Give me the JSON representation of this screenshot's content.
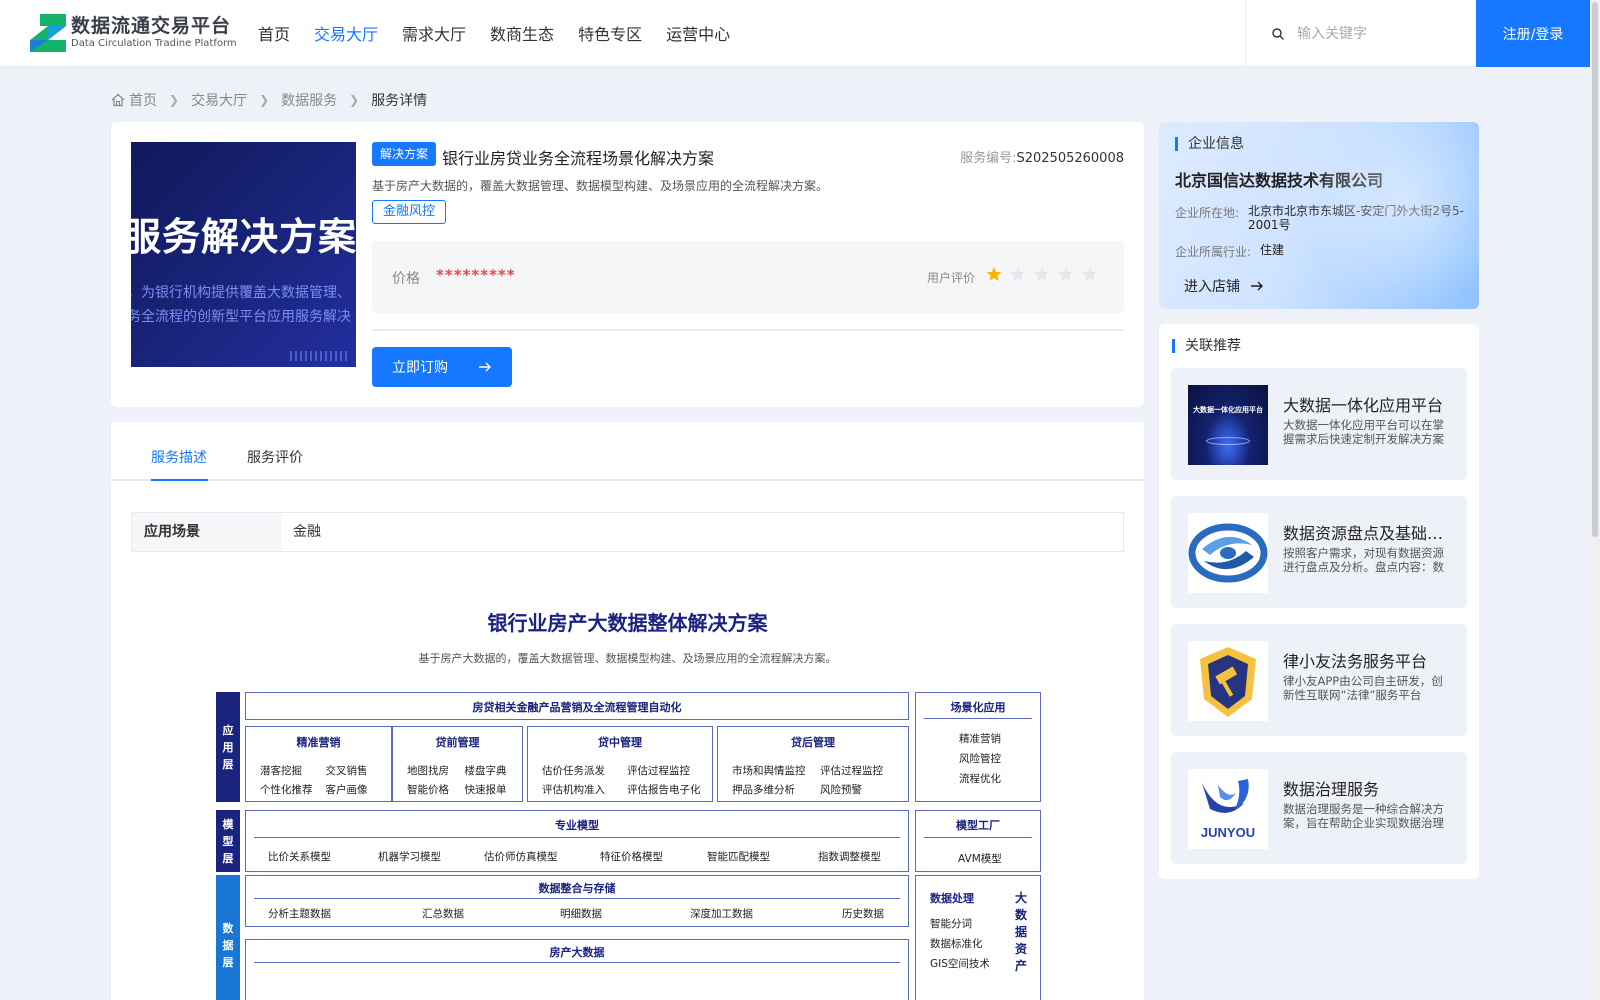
{
  "header": {
    "logo_cn": "数据流通交易平台",
    "logo_en": "Data Circulation Tradine Platform",
    "nav": [
      {
        "label": "首页",
        "active": false
      },
      {
        "label": "交易大厅",
        "active": true
      },
      {
        "label": "需求大厅",
        "active": false
      },
      {
        "label": "数商生态",
        "active": false
      },
      {
        "label": "特色专区",
        "active": false
      },
      {
        "label": "运营中心",
        "active": false
      }
    ],
    "search_placeholder": "输入关键字",
    "login_label": "注册/登录"
  },
  "breadcrumb": [
    "首页",
    "交易大厅",
    "数据服务",
    "服务详情"
  ],
  "product": {
    "cover_title": "服务解决方案",
    "cover_line1": "，为银行机构提供覆盖大数据管理、",
    "cover_line2": "务全流程的创新型平台应用服务解决",
    "type_tag": "解决方案",
    "title": "银行业房贷业务全流程场景化解决方案",
    "service_no_label": "服务编号:",
    "service_no": "S202505260008",
    "description": "基于房产大数据的，覆盖大数据管理、数据模型构建、及场景应用的全流程解决方案。",
    "category_tag": "金融风控",
    "price_label": "价格",
    "price_value": "*********",
    "rating_label": "用户评价",
    "rating": 1,
    "rating_max": 5,
    "buy_label": "立即订购"
  },
  "tabs": [
    {
      "label": "服务描述",
      "active": true
    },
    {
      "label": "服务评价",
      "active": false
    }
  ],
  "attributes": [
    {
      "key": "应用场景",
      "value": "金融"
    }
  ],
  "diagram": {
    "title": "银行业房产大数据整体解决方案",
    "subtitle": "基于房产大数据的，覆盖大数据管理、数据模型构建、及场景应用的全流程解决方案。",
    "layer_app": "应用层",
    "layer_model": "模型层",
    "layer_data": "数据层",
    "app_banner": "房贷相关金融产品营销及全流程管理自动化",
    "app_groups": [
      {
        "title": "精准营销",
        "items": [
          "潜客挖掘",
          "交叉销售",
          "个性化推荐",
          "客户画像"
        ]
      },
      {
        "title": "贷前管理",
        "items": [
          "地图找房",
          "楼盘字典",
          "智能价格",
          "快速报单"
        ]
      },
      {
        "title": "贷中管理",
        "items": [
          "估价任务派发",
          "评估过程监控",
          "评估机构准入",
          "评估报告电子化"
        ]
      },
      {
        "title": "贷后管理",
        "items": [
          "市场和舆情监控",
          "评估过程监控",
          "押品多维分析",
          "风险预警"
        ]
      }
    ],
    "scene_title": "场景化应用",
    "scene_items": [
      "精准营销",
      "风险管控",
      "流程优化"
    ],
    "model_title": "专业模型",
    "model_items": [
      "比价关系模型",
      "机器学习模型",
      "估价师仿真模型",
      "特征价格模型",
      "智能匹配模型",
      "指数调整模型"
    ],
    "factory_title": "模型工厂",
    "factory_item": "AVM模型",
    "integrate_title": "数据整合与存储",
    "integrate_items": [
      "分析主题数据",
      "汇总数据",
      "明细数据",
      "深度加工数据",
      "历史数据"
    ],
    "bigdata_title": "房产大数据",
    "process_title": "数据处理",
    "process_items": [
      "智能分词",
      "数据标准化",
      "GIS空间技术"
    ],
    "process_vertical": "大数据资产"
  },
  "company": {
    "section_title": "企业信息",
    "name": "北京国信达数据技术有限公司",
    "location_label": "企业所在地:",
    "location": "北京市北京市东城区-安定门外大街2号5-2001号",
    "industry_label": "企业所属行业:",
    "industry": "住建",
    "shop_label": "进入店铺"
  },
  "recommend": {
    "section_title": "关联推荐",
    "items": [
      {
        "name": "大数据一体化应用平台",
        "desc": "大数据一体化应用平台可以在掌握需求后快速定制开发解决方案",
        "thumb": "platform",
        "thumb_text": "大数据一体化应用平台"
      },
      {
        "name": "数据资源盘点及基础数据治理",
        "desc": "按照客户需求，对现有数据资源进行盘点及分析。盘点内容：数据",
        "thumb": "swirl",
        "thumb_text": ""
      },
      {
        "name": "律小友法务服务平台",
        "desc": "律小友APP由公司自主研发，创新性互联网“法律”服务平台",
        "thumb": "shield",
        "thumb_text": ""
      },
      {
        "name": "数据治理服务",
        "desc": "数据治理服务是一种综合解决方案，旨在帮助企业实现数据治理",
        "thumb": "junyou",
        "thumb_text": "JUNYOU"
      }
    ]
  }
}
